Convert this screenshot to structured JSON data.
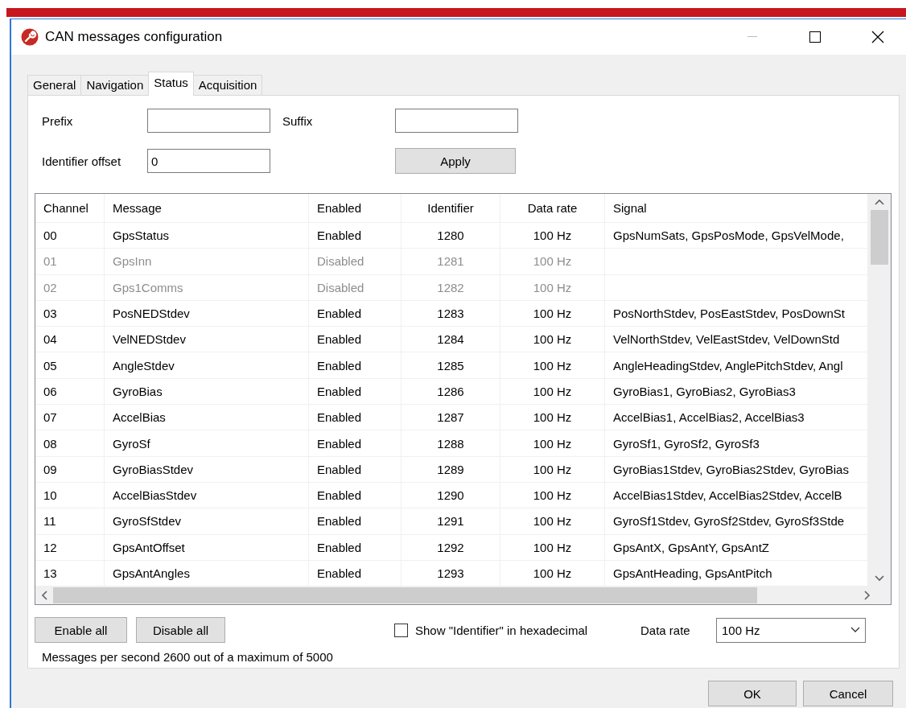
{
  "window": {
    "title": "CAN messages configuration"
  },
  "tabs": [
    {
      "label": "General",
      "selected": false
    },
    {
      "label": "Navigation",
      "selected": false
    },
    {
      "label": "Status",
      "selected": true
    },
    {
      "label": "Acquisition",
      "selected": false
    }
  ],
  "form": {
    "prefix_label": "Prefix",
    "suffix_label": "Suffix",
    "offset_label": "Identifier offset",
    "offset_value": "0",
    "apply": "Apply"
  },
  "table": {
    "columns": [
      "Channel",
      "Message",
      "Enabled",
      "Identifier",
      "Data rate",
      "Signal"
    ],
    "rows": [
      {
        "cells": [
          "00",
          "GpsStatus",
          "Enabled",
          "1280",
          "100 Hz",
          "GpsNumSats, GpsPosMode, GpsVelMode,"
        ],
        "disabled": false
      },
      {
        "cells": [
          "01",
          "GpsInn",
          "Disabled",
          "1281",
          "100 Hz",
          ""
        ],
        "disabled": true
      },
      {
        "cells": [
          "02",
          "Gps1Comms",
          "Disabled",
          "1282",
          "100 Hz",
          ""
        ],
        "disabled": true
      },
      {
        "cells": [
          "03",
          "PosNEDStdev",
          "Enabled",
          "1283",
          "100 Hz",
          "PosNorthStdev, PosEastStdev, PosDownSt"
        ],
        "disabled": false
      },
      {
        "cells": [
          "04",
          "VelNEDStdev",
          "Enabled",
          "1284",
          "100 Hz",
          "VelNorthStdev, VelEastStdev, VelDownStd"
        ],
        "disabled": false
      },
      {
        "cells": [
          "05",
          "AngleStdev",
          "Enabled",
          "1285",
          "100 Hz",
          "AngleHeadingStdev, AnglePitchStdev, Angl"
        ],
        "disabled": false
      },
      {
        "cells": [
          "06",
          "GyroBias",
          "Enabled",
          "1286",
          "100 Hz",
          "GyroBias1, GyroBias2, GyroBias3"
        ],
        "disabled": false
      },
      {
        "cells": [
          "07",
          "AccelBias",
          "Enabled",
          "1287",
          "100 Hz",
          "AccelBias1, AccelBias2, AccelBias3"
        ],
        "disabled": false
      },
      {
        "cells": [
          "08",
          "GyroSf",
          "Enabled",
          "1288",
          "100 Hz",
          "GyroSf1, GyroSf2, GyroSf3"
        ],
        "disabled": false
      },
      {
        "cells": [
          "09",
          "GyroBiasStdev",
          "Enabled",
          "1289",
          "100 Hz",
          "GyroBias1Stdev, GyroBias2Stdev, GyroBias"
        ],
        "disabled": false
      },
      {
        "cells": [
          "10",
          "AccelBiasStdev",
          "Enabled",
          "1290",
          "100 Hz",
          "AccelBias1Stdev, AccelBias2Stdev, AccelB"
        ],
        "disabled": false
      },
      {
        "cells": [
          "11",
          "GyroSfStdev",
          "Enabled",
          "1291",
          "100 Hz",
          "GyroSf1Stdev, GyroSf2Stdev, GyroSf3Stde"
        ],
        "disabled": false
      },
      {
        "cells": [
          "12",
          "GpsAntOffset",
          "Enabled",
          "1292",
          "100 Hz",
          "GpsAntX, GpsAntY, GpsAntZ"
        ],
        "disabled": false
      },
      {
        "cells": [
          "13",
          "GpsAntAngles",
          "Enabled",
          "1293",
          "100 Hz",
          "GpsAntHeading, GpsAntPitch"
        ],
        "disabled": false
      }
    ]
  },
  "bottom": {
    "enable_all": "Enable all",
    "disable_all": "Disable all",
    "hex_label": "Show \"Identifier\" in hexadecimal",
    "hex_checked": false,
    "rate_label": "Data rate",
    "rate_value": "100 Hz",
    "status": "Messages per second 2600 out of a maximum of 5000"
  },
  "buttons": [
    "OK",
    "Cancel"
  ]
}
